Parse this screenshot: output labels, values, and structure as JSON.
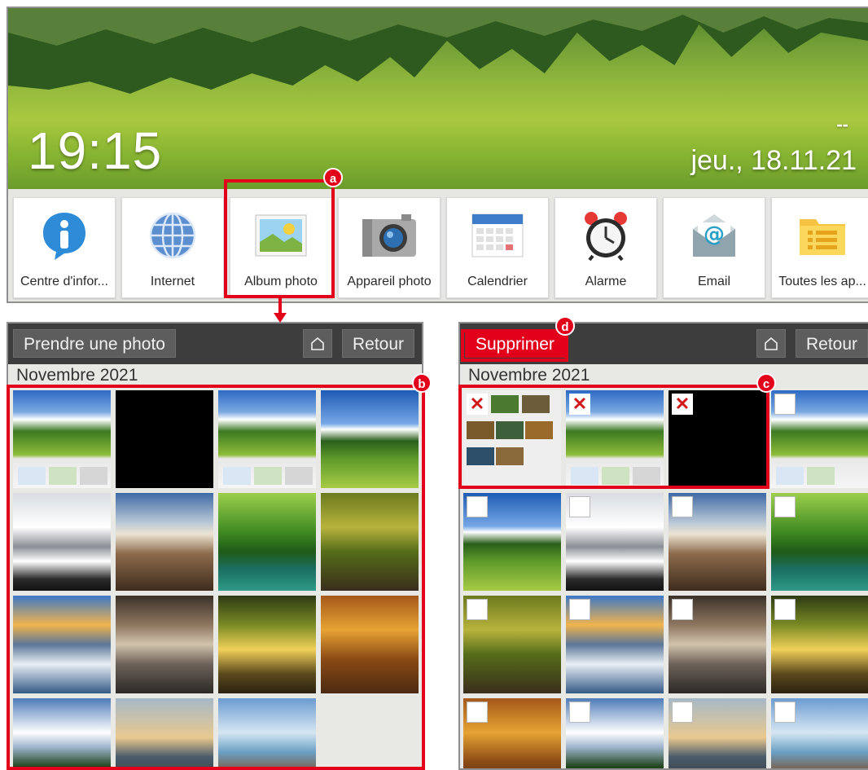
{
  "home": {
    "clock": "19:15",
    "date_dash": "--",
    "date": "jeu., 18.11.21",
    "apps": [
      {
        "label": "Centre d'infor...",
        "icon": "info-icon"
      },
      {
        "label": "Internet",
        "icon": "globe-icon"
      },
      {
        "label": "Album photo",
        "icon": "photo-album-icon"
      },
      {
        "label": "Appareil photo",
        "icon": "camera-icon"
      },
      {
        "label": "Calendrier",
        "icon": "calendar-icon"
      },
      {
        "label": "Alarme",
        "icon": "alarm-clock-icon"
      },
      {
        "label": "Email",
        "icon": "email-icon"
      },
      {
        "label": "Toutes les ap...",
        "icon": "all-apps-icon"
      }
    ]
  },
  "gallery_left": {
    "take_photo_label": "Prendre une photo",
    "home_icon": "home-icon",
    "back_label": "Retour",
    "section": "Novembre 2021"
  },
  "gallery_right": {
    "delete_label": "Supprimer",
    "home_icon": "home-icon",
    "back_label": "Retour",
    "section": "Novembre 2021"
  },
  "annotations": {
    "a": "a",
    "b": "b",
    "c": "c",
    "d": "d"
  },
  "colors": {
    "highlight": "#e2001a",
    "toolbar": "#3d3d3d",
    "button": "#5d5d5d",
    "background": "#e8e8e5"
  }
}
